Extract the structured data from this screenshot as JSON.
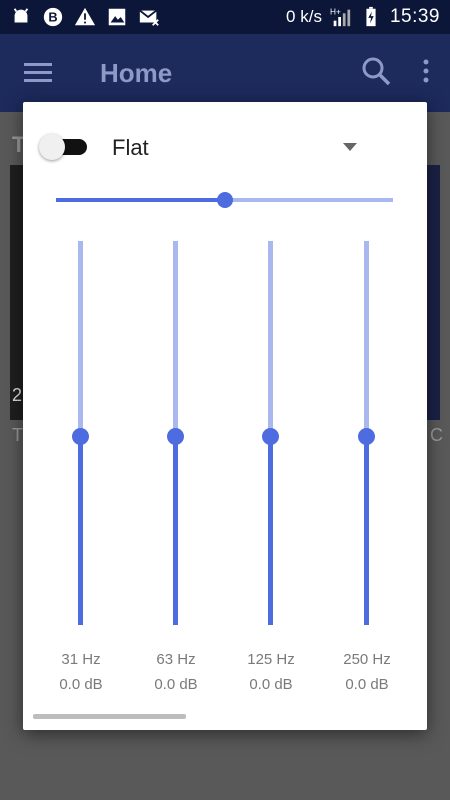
{
  "status_bar": {
    "speed": "0 k/s",
    "network": "H+",
    "time": "15:39",
    "icons": [
      "android-icon",
      "b-app-icon",
      "warning-icon",
      "image-icon",
      "mail-icon",
      "signal-icon",
      "battery-charging-icon"
    ]
  },
  "app_bar": {
    "title": "Home",
    "icons": [
      "menu-icon",
      "search-icon",
      "more-vert-icon"
    ]
  },
  "background": {
    "letter_top": "T",
    "letter_mid": "2",
    "letter_bottom": "T",
    "letter_right_bottom": "C"
  },
  "equalizer": {
    "enabled": false,
    "preset": "Flat",
    "bass_boost_level": 0.5,
    "bands": [
      {
        "freq": "31 Hz",
        "gain": "0.0 dB",
        "level": 0.5
      },
      {
        "freq": "63 Hz",
        "gain": "0.0 dB",
        "level": 0.5
      },
      {
        "freq": "125 Hz",
        "gain": "0.0 dB",
        "level": 0.5
      },
      {
        "freq": "250 Hz",
        "gain": "0.0 dB",
        "level": 0.5
      }
    ]
  },
  "colors": {
    "accent": "#4c6ce0",
    "accent_light": "#aab8f0",
    "status_bar": "#0c1638",
    "app_bar": "#1c2a5c"
  }
}
